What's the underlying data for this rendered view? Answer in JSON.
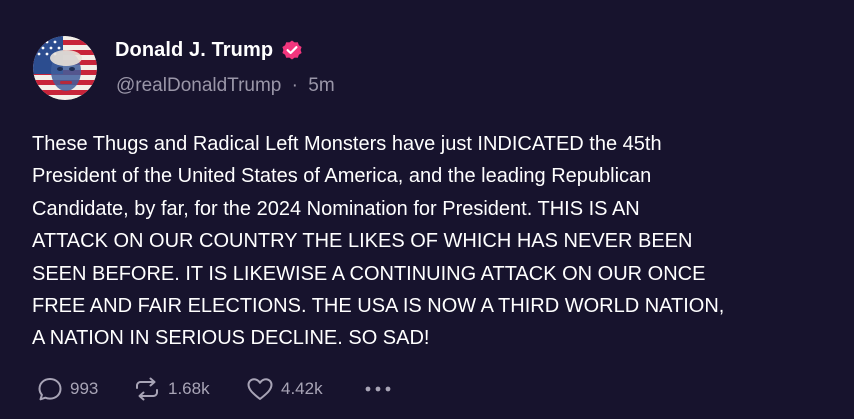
{
  "author": {
    "display_name": "Donald J. Trump",
    "handle": "@realDonaldTrump",
    "separator": "·",
    "time": "5m"
  },
  "post": {
    "lines": [
      "These Thugs and Radical Left Monsters have just INDICATED the 45th",
      "President of the United States of America, and the leading Republican",
      "Candidate, by far, for the 2024 Nomination for President. THIS IS AN",
      "ATTACK ON OUR COUNTRY THE LIKES OF WHICH HAS NEVER BEEN",
      "SEEN BEFORE. IT IS LIKEWISE A CONTINUING ATTACK ON OUR ONCE",
      "FREE AND FAIR ELECTIONS. THE USA IS NOW A THIRD WORLD NATION,",
      "A NATION IN SERIOUS DECLINE. SO SAD!"
    ]
  },
  "actions": {
    "replies": "993",
    "reposts": "1.68k",
    "likes": "4.42k"
  },
  "icons": {
    "reply": "speech-bubble-icon",
    "repost": "repost-arrows-icon",
    "like": "heart-icon",
    "more": "more-dots-icon",
    "verified": "verified-badge-icon"
  },
  "colors": {
    "background": "#17132d",
    "verified_badge": "#f2367d",
    "muted_text": "#9a96a8"
  }
}
